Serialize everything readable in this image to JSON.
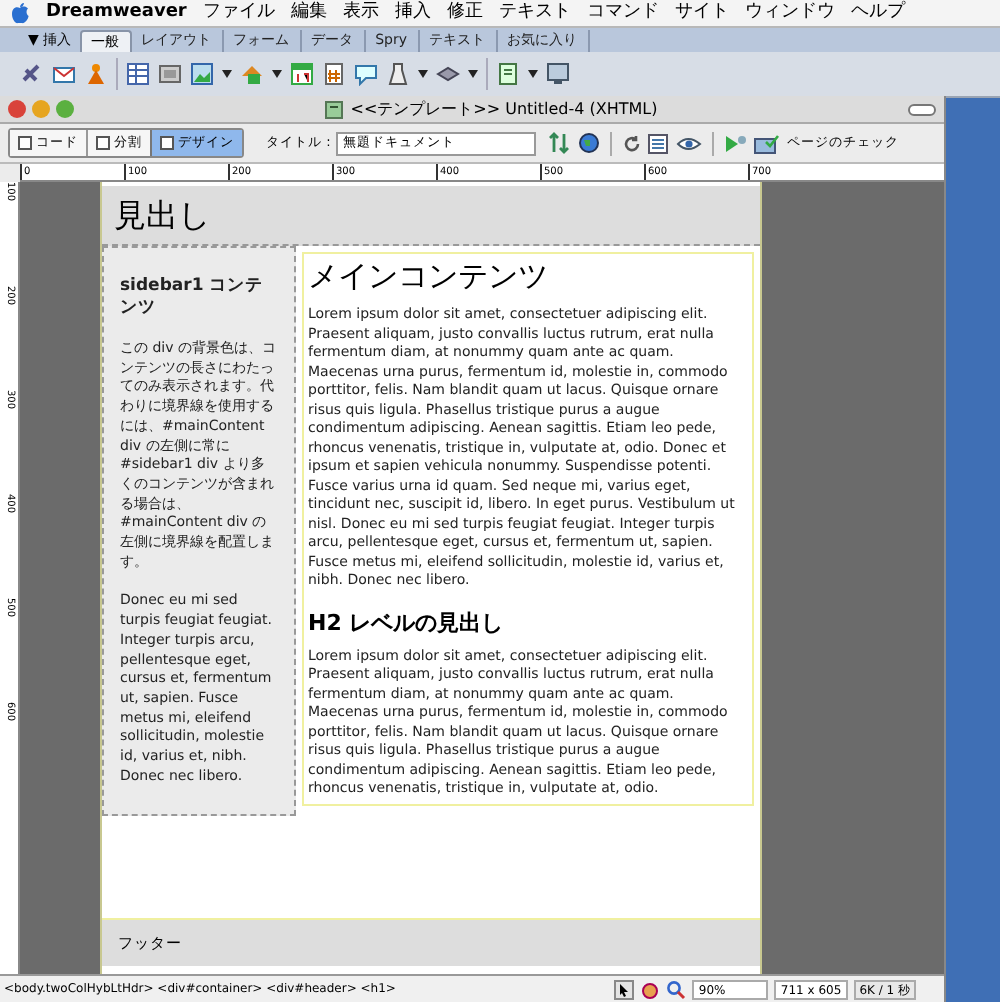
{
  "menu_bar": {
    "app": "Dreamweaver",
    "items": [
      "ファイル",
      "編集",
      "表示",
      "挿入",
      "修正",
      "テキスト",
      "コマンド",
      "サイト",
      "ウィンドウ",
      "ヘルプ"
    ]
  },
  "insert_bar": {
    "label": "▼ 挿入",
    "tabs": [
      {
        "label": "一般",
        "selected": true
      },
      {
        "label": "レイアウト",
        "selected": false
      },
      {
        "label": "フォーム",
        "selected": false
      },
      {
        "label": "データ",
        "selected": false
      },
      {
        "label": "Spry",
        "selected": false
      },
      {
        "label": "テキスト",
        "selected": false
      },
      {
        "label": "お気に入り",
        "selected": false
      }
    ]
  },
  "document": {
    "title": "<<テンプレート>> Untitled-4 (XHTML)",
    "view_buttons": [
      {
        "label": "コード",
        "selected": false
      },
      {
        "label": "分割",
        "selected": false
      },
      {
        "label": "デザイン",
        "selected": true
      }
    ],
    "title_label": "タイトル :",
    "title_value": "無題ドキュメント",
    "check_page": "ページのチェック",
    "ruler": [
      "0",
      "100",
      "200",
      "300",
      "400",
      "500",
      "600",
      "700"
    ],
    "vertical_ruler": [
      "100",
      "200",
      "300",
      "400",
      "500",
      "600"
    ]
  },
  "page": {
    "header": "見出し",
    "sidebar": {
      "heading": "sidebar1 コンテンツ",
      "paragraphs": [
        "この div の背景色は、コンテンツの長さにわたってのみ表示されます。代わりに境界線を使用するには、#mainContent div の左側に常に #sidebar1 div より多くのコンテンツが含まれる場合は、#mainContent div の左側に境界線を配置します。",
        "Donec eu mi sed turpis feugiat feugiat. Integer turpis arcu, pellentesque eget, cursus et, fermentum ut, sapien. Fusce metus mi, eleifend sollicitudin, molestie id, varius et, nibh. Donec nec libero."
      ]
    },
    "main": {
      "heading": "メインコンテンツ",
      "paragraph_1": "Lorem ipsum dolor sit amet, consectetuer adipiscing elit. Praesent aliquam, justo convallis luctus rutrum, erat nulla fermentum diam, at nonummy quam ante ac quam. Maecenas urna purus, fermentum id, molestie in, commodo porttitor, felis. Nam blandit quam ut lacus. Quisque ornare risus quis ligula. Phasellus tristique purus a augue condimentum adipiscing. Aenean sagittis. Etiam leo pede, rhoncus venenatis, tristique in, vulputate at, odio. Donec et ipsum et sapien vehicula nonummy. Suspendisse potenti. Fusce varius urna id quam. Sed neque mi, varius eget, tincidunt nec, suscipit id, libero. In eget purus. Vestibulum ut nisl. Donec eu mi sed turpis feugiat feugiat. Integer turpis arcu, pellentesque eget, cursus et, fermentum ut, sapien. Fusce metus mi, eleifend sollicitudin, molestie id, varius et, nibh. Donec nec libero.",
      "subheading": "H2 レベルの見出し",
      "paragraph_2": "Lorem ipsum dolor sit amet, consectetuer adipiscing elit. Praesent aliquam, justo convallis luctus rutrum, erat nulla fermentum diam, at nonummy quam ante ac quam. Maecenas urna purus, fermentum id, molestie in, commodo porttitor, felis. Nam blandit quam ut lacus. Quisque ornare risus quis ligula. Phasellus tristique purus a augue condimentum adipiscing. Aenean sagittis. Etiam leo pede, rhoncus venenatis, tristique in, vulputate at, odio."
    },
    "footer": "フッター"
  },
  "status_bar": {
    "tag_path": "<body.twoColHybLtHdr> <div#container> <div#header> <h1>",
    "zoom": "90%",
    "size": "711 x 605",
    "download": "6K / 1 秒"
  }
}
